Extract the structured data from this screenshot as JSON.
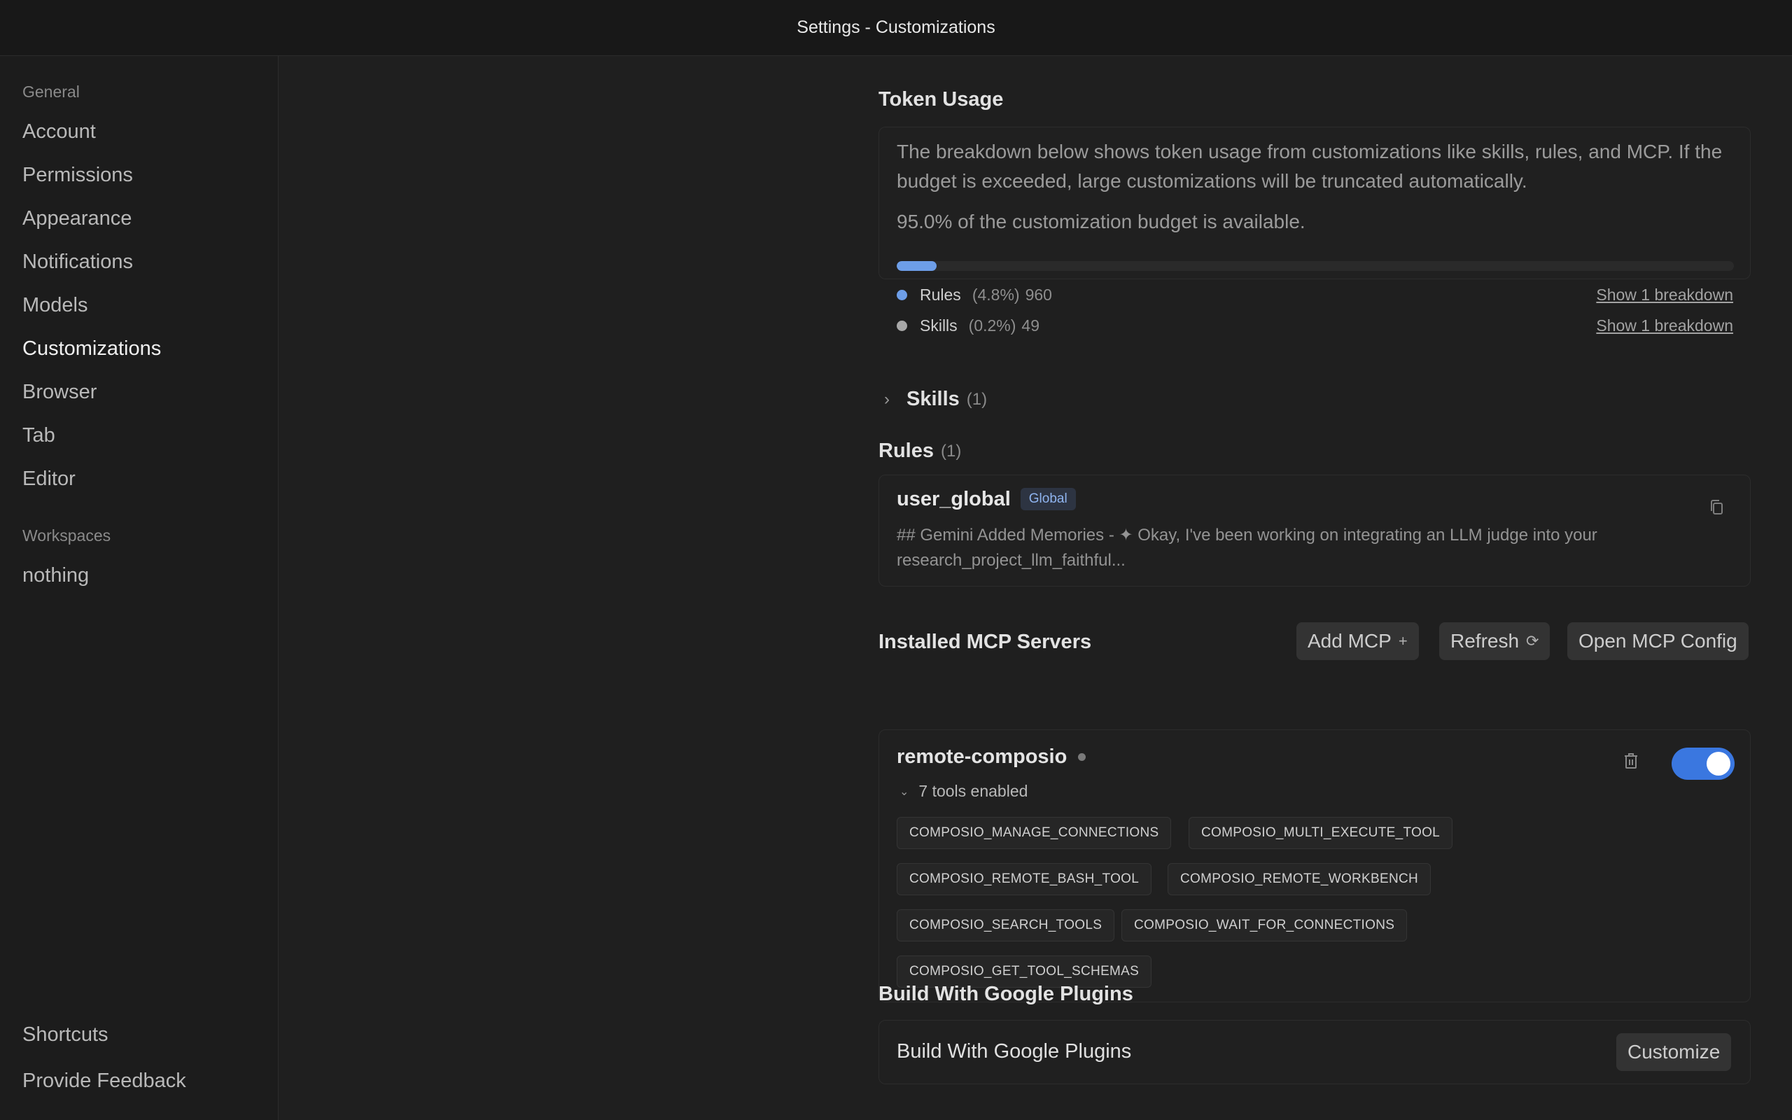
{
  "window": {
    "title": "Settings - Customizations"
  },
  "sidebar": {
    "general_label": "General",
    "items": [
      {
        "label": "Account"
      },
      {
        "label": "Permissions"
      },
      {
        "label": "Appearance"
      },
      {
        "label": "Notifications"
      },
      {
        "label": "Models"
      },
      {
        "label": "Customizations",
        "active": true
      },
      {
        "label": "Browser"
      },
      {
        "label": "Tab"
      },
      {
        "label": "Editor"
      }
    ],
    "workspaces_label": "Workspaces",
    "workspaces": [
      {
        "label": "nothing"
      }
    ],
    "footer": [
      {
        "label": "Shortcuts"
      },
      {
        "label": "Provide Feedback"
      }
    ]
  },
  "token_usage": {
    "title": "Token Usage",
    "description": "The breakdown below shows token usage from customizations like skills, rules, and MCP. If the budget is exceeded, large customizations will be truncated automatically.",
    "budget_text": "95.0% of the customization budget is available.",
    "rules_fill_percent": 4.8,
    "skills_fill_percent": 0.2,
    "rows": [
      {
        "name": "Rules",
        "percent": "(4.8%)",
        "tokens": "960",
        "link": "Show 1 breakdown",
        "color": "#6d9ee8"
      },
      {
        "name": "Skills",
        "percent": "(0.2%)",
        "tokens": "49",
        "link": "Show 1 breakdown",
        "color": "#a8a8a8"
      }
    ]
  },
  "skills": {
    "title": "Skills",
    "count": "(1)",
    "expanded": false
  },
  "rules": {
    "title": "Rules",
    "count": "(1)",
    "items": [
      {
        "name": "user_global",
        "badge": "Global",
        "preview": "## Gemini Added Memories - ✦ Okay, I've been working on integrating an LLM judge into your research_project_llm_faithful..."
      }
    ]
  },
  "mcp": {
    "title": "Installed MCP Servers",
    "add_label": "Add MCP",
    "refresh_label": "Refresh",
    "open_config_label": "Open MCP Config",
    "servers": [
      {
        "name": "remote-composio",
        "enabled": true,
        "tools_summary": "7 tools enabled",
        "tools": [
          "COMPOSIO_MANAGE_CONNECTIONS",
          "COMPOSIO_MULTI_EXECUTE_TOOL",
          "COMPOSIO_REMOTE_BASH_TOOL",
          "COMPOSIO_REMOTE_WORKBENCH",
          "COMPOSIO_SEARCH_TOOLS",
          "COMPOSIO_WAIT_FOR_CONNECTIONS",
          "COMPOSIO_GET_TOOL_SCHEMAS"
        ]
      }
    ]
  },
  "plugins": {
    "title": "Build With Google Plugins",
    "row_label": "Build With Google Plugins",
    "button_label": "Customize"
  }
}
